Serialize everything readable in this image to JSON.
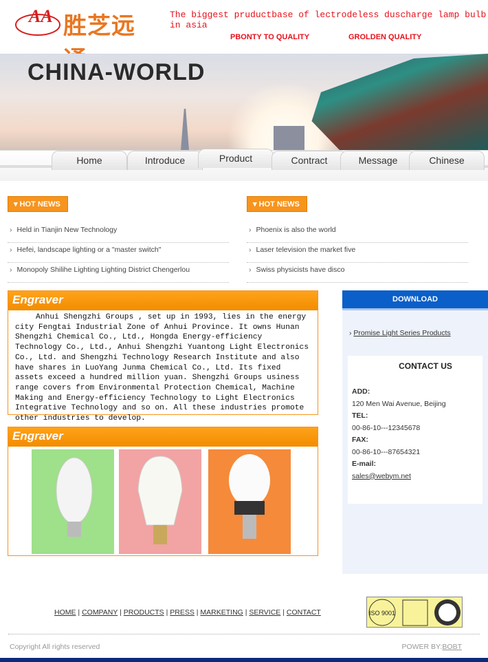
{
  "header": {
    "logo_text": "胜芝远通",
    "logo_mark": "AA",
    "slogan": "The biggest pruductbase of lectrodeless duscharge lamp bulb in asia",
    "quality_1": "PBONTY TO QUALITY",
    "quality_2": "GROLDEN QUALITY"
  },
  "banner": {
    "title": "CHINA-WORLD"
  },
  "nav": {
    "items": [
      "Home",
      "Introduce",
      "Product",
      "Contract",
      "Message",
      "Chinese"
    ]
  },
  "news_left": {
    "header": "HOT NEWS",
    "items": [
      "Held in Tianjin New Technology",
      "Hefei, landscape lighting or a \"master switch\"",
      "Monopoly Shilihe Lighting Lighting District Chengerlou"
    ]
  },
  "news_right": {
    "header": "HOT NEWS",
    "items": [
      "Phoenix is also the world",
      "Laser television the market five",
      "Swiss physicists have disco"
    ]
  },
  "about": {
    "header": "Engraver",
    "text": "Anhui Shengzhi Groups , set up in 1993, lies in the energy city Fengtai Industrial Zone of Anhui Province. It owns Hunan Shengzhi Chemical Co., Ltd., Hongda Energy-efficiency Technology Co., Ltd., Anhui Shengzhi Yuantong Light Electronics Co., Ltd. and Shengzhi Technology Research Institute and also have shares in LuoYang Junma Chemical Co., Ltd. Its fixed assets exceed a hundred million yuan. Shengzhi Groups usiness range covers from Environmental Protection Chemical, Machine Making and Energy-efficiency Technology to Light Electronics Integrative Technology and so on. All these industries promote other industries to develop."
  },
  "products": {
    "header": "Engraver",
    "bg_colors": [
      "#9fe08a",
      "#f2a3a3",
      "#f58a3a"
    ]
  },
  "download": {
    "header": "DOWNLOAD",
    "link": "Promise Light Series Products"
  },
  "contact": {
    "header": "CONTACT US",
    "add_label": "ADD:",
    "add": "120 Men Wai Avenue, Beijing",
    "tel_label": "TEL:",
    "tel": "00-86-10---12345678",
    "fax_label": "FAX:",
    "fax": "00-86-10---87654321",
    "email_label": "E-mail:",
    "email": "sales@webym.net"
  },
  "footer": {
    "links": [
      "HOME",
      "COMPANY",
      "PRODUCTS",
      "PRESS",
      "MARKETING",
      "SERVICE",
      "CONTACT"
    ],
    "copyright": "Copyright All rights reserved",
    "power_label": "POWER BY:",
    "power_link": "BOBT",
    "seal_text": "ISO 9001"
  }
}
